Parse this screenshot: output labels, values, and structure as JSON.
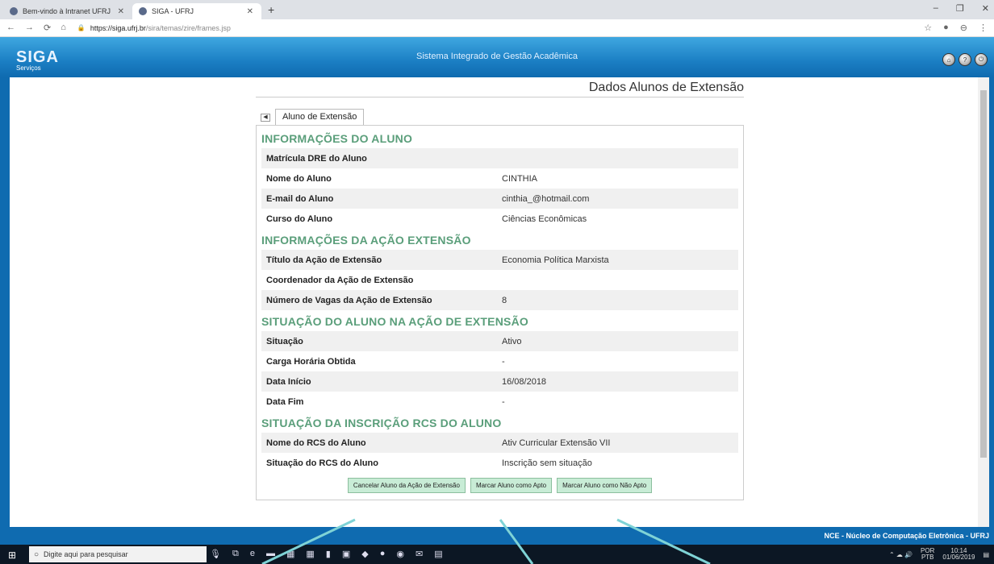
{
  "browser": {
    "tabs": [
      {
        "title": "Bem-vindo à Intranet UFRJ | Intra",
        "active": false
      },
      {
        "title": "SIGA - UFRJ",
        "active": true
      }
    ],
    "new_tab": "+",
    "window_controls": [
      "–",
      "❐",
      "✕"
    ],
    "nav": {
      "back": "←",
      "forward": "→",
      "reload": "⟳",
      "home": "⌂"
    },
    "url": {
      "lock": "🔒",
      "host": "https://siga.ufrj.br",
      "path": "/sira/temas/zire/frames.jsp"
    },
    "addr_icons": [
      "☆",
      "●",
      "⊖",
      "⋮"
    ]
  },
  "siga": {
    "logo": "SIGA",
    "subtitle": "Sistema Integrado de Gestão Acadêmica",
    "menu": "Serviços",
    "header_buttons": [
      "⌂",
      "?",
      "⏻"
    ]
  },
  "page": {
    "title": "Dados Alunos de Extensão",
    "tab_icon": "◀",
    "tab_label": "Aluno de Extensão",
    "sections": [
      {
        "heading": "INFORMAÇÕES DO ALUNO",
        "rows": [
          {
            "label": "Matrícula DRE do Aluno",
            "value": ""
          },
          {
            "label": "Nome do Aluno",
            "value": "CINTHIA"
          },
          {
            "label": "E-mail do Aluno",
            "value": "cinthia_@hotmail.com"
          },
          {
            "label": "Curso do Aluno",
            "value": "Ciências Econômicas"
          }
        ]
      },
      {
        "heading": "INFORMAÇÕES DA AÇÃO EXTENSÃO",
        "rows": [
          {
            "label": "Título da Ação de Extensão",
            "value": "Economia Política Marxista"
          },
          {
            "label": "Coordenador da Ação de Extensão",
            "value": ""
          },
          {
            "label": "Número de Vagas da Ação de Extensão",
            "value": "8"
          }
        ]
      },
      {
        "heading": "SITUAÇÃO DO ALUNO NA AÇÃO DE EXTENSÃO",
        "rows": [
          {
            "label": "Situação",
            "value": "Ativo"
          },
          {
            "label": "Carga Horária Obtida",
            "value": "-"
          },
          {
            "label": "Data Início",
            "value": "16/08/2018"
          },
          {
            "label": "Data Fim",
            "value": "-"
          }
        ]
      },
      {
        "heading": "SITUAÇÃO DA INSCRIÇÃO RCS DO ALUNO",
        "rows": [
          {
            "label": "Nome do RCS do Aluno",
            "value": "Ativ Curricular Extensão VII"
          },
          {
            "label": "Situação do RCS do Aluno",
            "value": "Inscrição sem situação"
          }
        ]
      }
    ],
    "buttons": [
      {
        "name": "cancel-student-button",
        "label": "Cancelar Aluno da Ação de Extensão"
      },
      {
        "name": "mark-apt-button",
        "label": "Marcar Aluno como Apto"
      },
      {
        "name": "mark-not-apt-button",
        "label": "Marcar Aluno como Não Apto"
      }
    ]
  },
  "footer": "NCE - Núcleo de Computação Eletrônica - UFRJ",
  "taskbar": {
    "start": "⊞",
    "search_icon": "○",
    "search_placeholder": "Digite aqui para pesquisar",
    "icons": [
      "🎙",
      "⧉",
      "e",
      "▬",
      "▦",
      "▦",
      "▮",
      "▣",
      "◆",
      "●",
      "◉",
      "✉",
      "▤"
    ],
    "tray": {
      "lang": "POR",
      "layout": "PTB",
      "time": "10:14",
      "date": "01/06/2019"
    }
  },
  "annotation_color": "#7fd3d6"
}
